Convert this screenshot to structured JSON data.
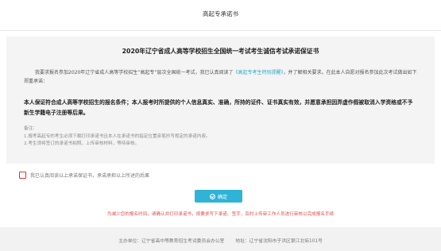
{
  "header": {
    "title": "高起专承诺书"
  },
  "panel": {
    "heading": "2020年辽宁省成人高等学校招生全国统一考试考生诚信考试承诺保证书",
    "para1_before": "我要求报名参加2020年辽宁省成人高等学校招生“高起专”层次全国统一考试，我已认真阅读了",
    "para1_link": "《高起专考生特别提醒》",
    "para1_after": "，并了解相关要求。在此本人自愿对报名参加此次考试做出如下郑重承诺：",
    "para2": "本人保证符合成人高等学校招生的报名条件；本人报考时所提供的个人信息真实、准确，所持的证件、证书真实有效，并愿意承担因弄虚作假被取消入学资格或不予新生学籍电子注册等后果。",
    "notes_title": "备注：",
    "note1": "1.报考高起专的考生必须下载打印承诺书且本人在承诺书的指定位置亲笔抄写规定的承诺内容。",
    "note2": "2.考生须将签订的承诺书拍照，上传审核材料，等待审核。"
  },
  "agree": {
    "label": "我已认真阅读以上承诺保证书，承诺承担以上所述的后果"
  },
  "confirm_button": {
    "label": "确定"
  },
  "warning": "为减少您的报名时间，请确认并打印承诺书，按要求写下承诺、签字，及时上传审工作人员进行审核以完成报名手续",
  "footer": {
    "organizer": "主办单位：辽宁省高中等教育招生考试委员会办公室",
    "address": "地址：辽宁省沈阳市于洪区银江北街101号"
  },
  "colors": {
    "accent": "#2fb3d6",
    "warning": "#e64b4b",
    "link": "#2aa9c7"
  }
}
